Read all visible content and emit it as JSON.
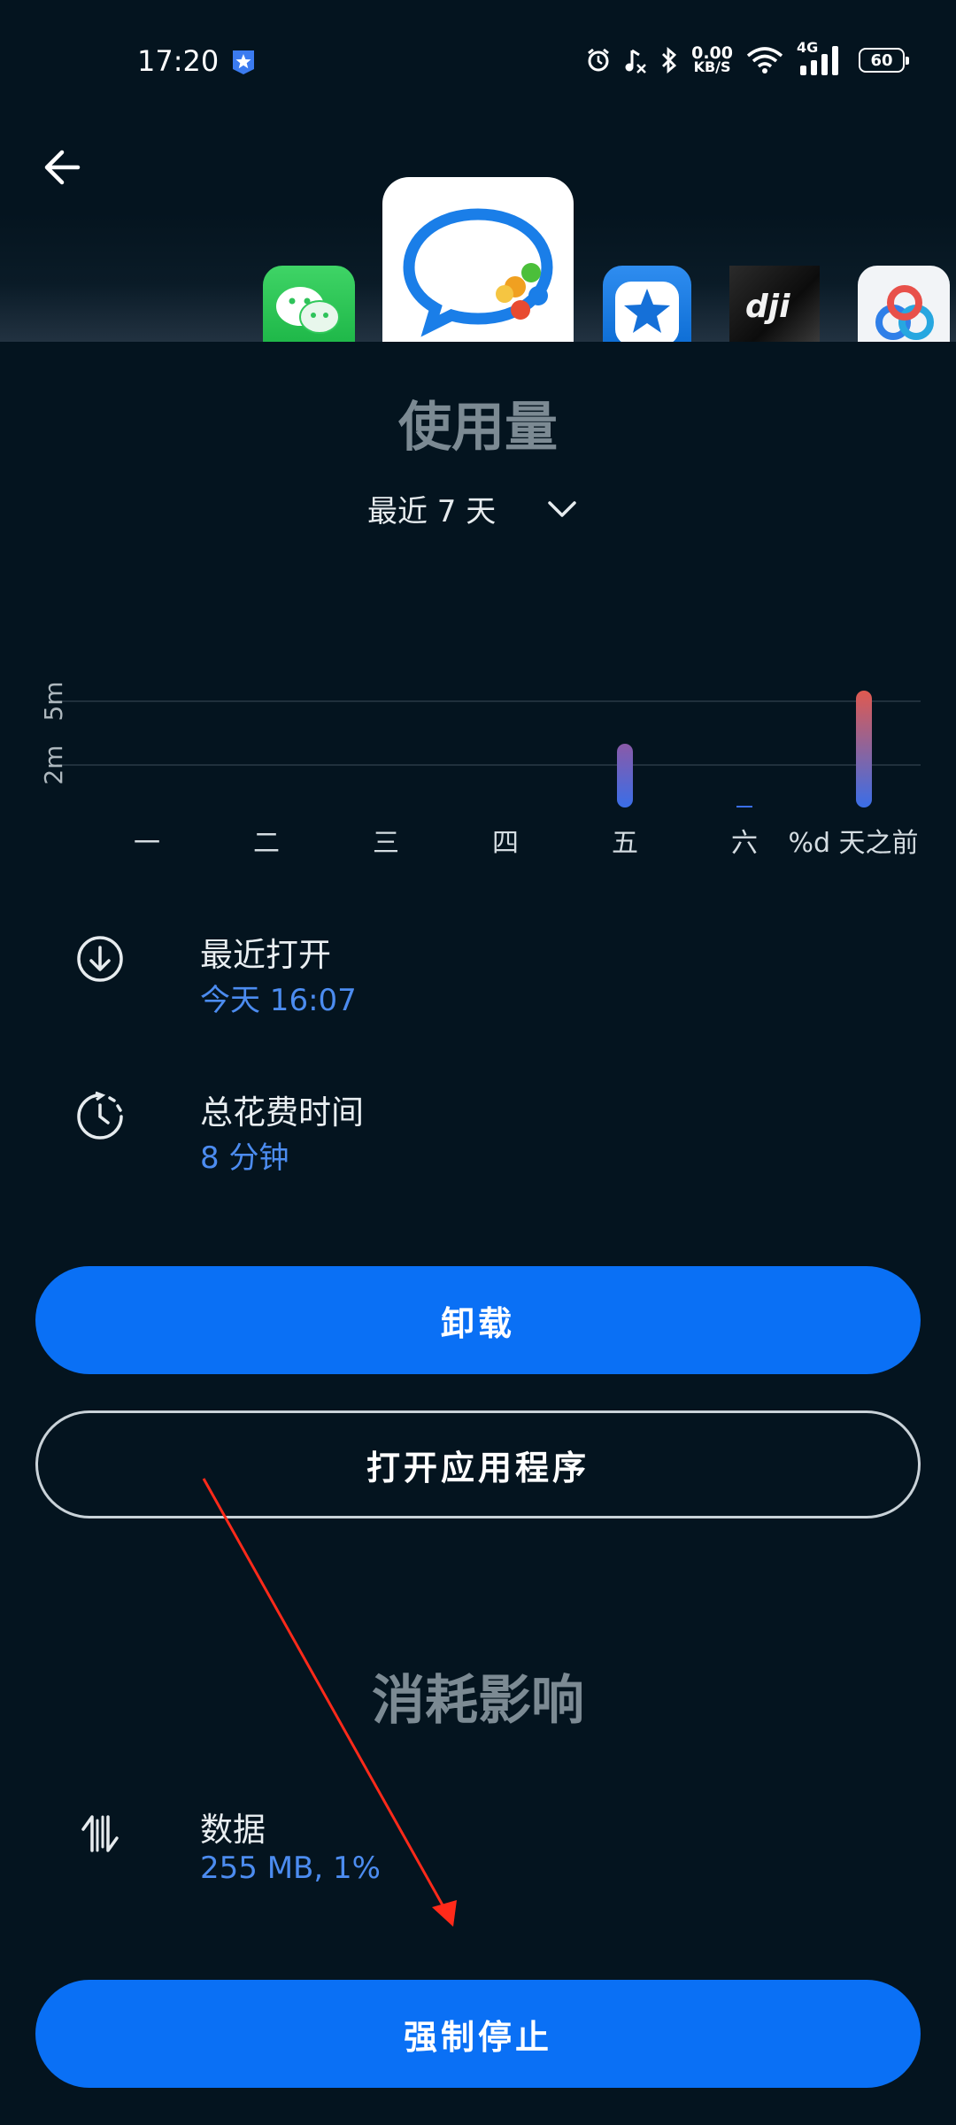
{
  "status_bar": {
    "time": "17:20",
    "net_speed_value": "0.00",
    "net_speed_unit": "KB/S",
    "network_type": "4G",
    "battery": "60"
  },
  "header": {
    "back_icon": "arrow-left-icon",
    "apps": [
      "wechat-icon",
      "enterprise-wechat-icon",
      "star-app-icon",
      "dji-icon",
      "cloud-app-icon"
    ]
  },
  "usage": {
    "title": "使用量",
    "range_label": "最近 7 天"
  },
  "chart_data": {
    "type": "bar",
    "categories": [
      "一",
      "二",
      "三",
      "四",
      "五",
      "六",
      "%d 天之前"
    ],
    "values": [
      0,
      0,
      0,
      0,
      3,
      0,
      5.5
    ],
    "y_ticks": [
      "2m",
      "5m"
    ],
    "y_tick_values": [
      2,
      5
    ],
    "ylim": [
      0,
      6
    ],
    "grid": true,
    "colors": {
      "low": "#3a6ee8",
      "high": "#e05a50",
      "mid": "#8a5aa8",
      "grid": "#2a3a46"
    }
  },
  "info": {
    "last_opened_title": "最近打开",
    "last_opened_value": "今天 16:07",
    "total_time_title": "总花费时间",
    "total_time_value": "8 分钟"
  },
  "actions": {
    "uninstall": "卸载",
    "open_app": "打开应用程序",
    "force_stop": "强制停止"
  },
  "impact": {
    "title": "消耗影响",
    "data_title": "数据",
    "data_value": "255 MB, 1%"
  }
}
